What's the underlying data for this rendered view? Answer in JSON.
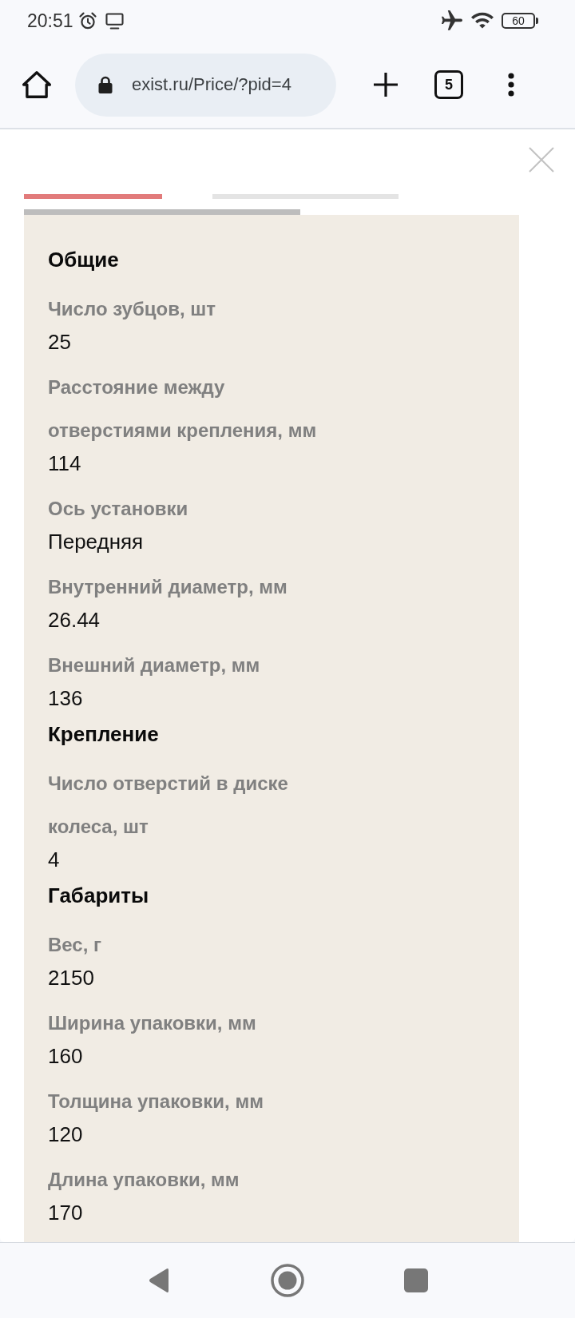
{
  "status_bar": {
    "time": "20:51",
    "battery": "60"
  },
  "toolbar": {
    "url": "exist.ru/Price/?pid=4",
    "tab_count": "5"
  },
  "tabs": [
    {
      "selected": true
    },
    {
      "selected": false
    }
  ],
  "sections": [
    {
      "title": "Общие",
      "fields": [
        {
          "label": "Число зубцов, шт",
          "value": "25"
        },
        {
          "label": "Расстояние между отверстиями крепления, мм",
          "value": "114"
        },
        {
          "label": "Ось установки",
          "value": "Передняя"
        },
        {
          "label": "Внутренний диаметр, мм",
          "value": "26.44"
        },
        {
          "label": "Внешний диаметр, мм",
          "value": "136"
        }
      ]
    },
    {
      "title": "Крепление",
      "fields": [
        {
          "label": "Число отверстий в диске колеса, шт",
          "value": "4"
        }
      ]
    },
    {
      "title": "Габариты",
      "fields": [
        {
          "label": "Вес, г",
          "value": "2150"
        },
        {
          "label": "Ширина упаковки, мм",
          "value": "160"
        },
        {
          "label": "Толщина упаковки, мм",
          "value": "120"
        },
        {
          "label": "Длина упаковки, мм",
          "value": "170"
        }
      ]
    }
  ]
}
